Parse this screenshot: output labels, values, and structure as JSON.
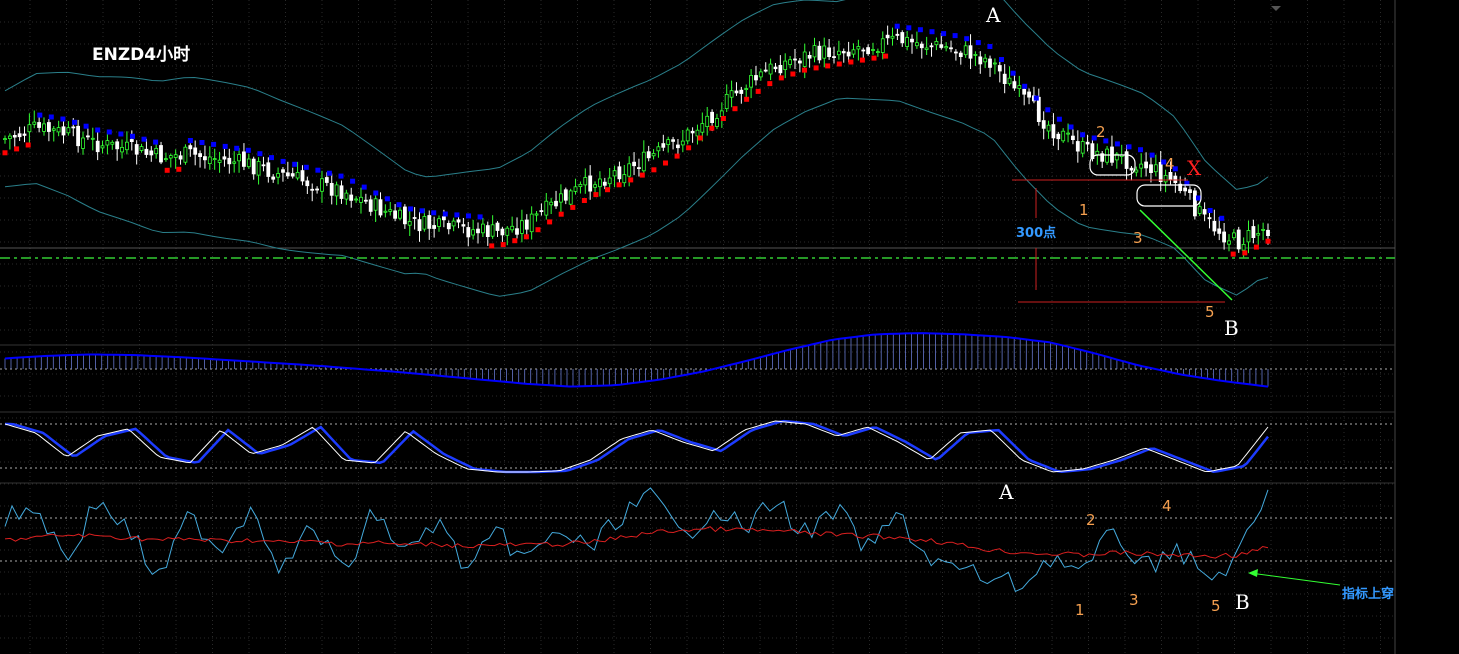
{
  "title": "ENZD4小时",
  "colors": {
    "background": "#000000",
    "bull_candle": "#33ff33",
    "bear_candle": "#ffffff",
    "sar_up": "#ff0000",
    "sar_down": "#0000ff",
    "bollinger": "#2a7f8a",
    "dashed_level": "#33cc33",
    "macd_line": "#0000ff",
    "macd_hist": "#6677cc",
    "stoch_main": "#ffffff",
    "stoch_signal": "#1d3cff",
    "osc_fast": "#44aadd",
    "osc_slow": "#dd2020",
    "annotation_orange": "#f5a050"
  },
  "annotations": {
    "price_A": "A",
    "price_B": "B",
    "price_X": "X",
    "wave_1": "1",
    "wave_2": "2",
    "wave_3": "3",
    "wave_4": "4",
    "wave_5": "5",
    "range_label": "300点",
    "osc_A": "A",
    "osc_B": "B",
    "osc_1": "1",
    "osc_2": "2",
    "osc_3": "3",
    "osc_4": "4",
    "osc_5": "5",
    "indicator_note": "指标上穿"
  },
  "chart_data": {
    "type": "line",
    "note_panels": [
      "price_candles_bollinger_sar",
      "macd",
      "stochastic",
      "oscillator"
    ],
    "price_curve": [
      0.62,
      0.66,
      0.64,
      0.6,
      0.58,
      0.55,
      0.56,
      0.54,
      0.52,
      0.48,
      0.45,
      0.42,
      0.36,
      0.3,
      0.28,
      0.27,
      0.26,
      0.3,
      0.38,
      0.45,
      0.5,
      0.55,
      0.62,
      0.72,
      0.82,
      0.9,
      0.94,
      0.96,
      0.98,
      1.0,
      0.98,
      0.96,
      0.92,
      0.78,
      0.66,
      0.58,
      0.55,
      0.52,
      0.45,
      0.3,
      0.22,
      0.28
    ],
    "macd_line": [
      0.62,
      0.66,
      0.68,
      0.67,
      0.64,
      0.6,
      0.56,
      0.52,
      0.47,
      0.42,
      0.36,
      0.3,
      0.24,
      0.2,
      0.22,
      0.3,
      0.42,
      0.58,
      0.75,
      0.9,
      0.98,
      1.0,
      0.98,
      0.94,
      0.86,
      0.7,
      0.52,
      0.38,
      0.28,
      0.2
    ],
    "stoch_main": [
      0.9,
      0.75,
      0.35,
      0.7,
      0.82,
      0.35,
      0.25,
      0.8,
      0.4,
      0.55,
      0.85,
      0.3,
      0.25,
      0.78,
      0.4,
      0.15,
      0.1,
      0.1,
      0.12,
      0.3,
      0.65,
      0.8,
      0.6,
      0.45,
      0.8,
      0.95,
      0.9,
      0.7,
      0.85,
      0.6,
      0.3,
      0.75,
      0.8,
      0.3,
      0.1,
      0.15,
      0.3,
      0.5,
      0.3,
      0.1,
      0.2,
      0.85
    ],
    "osc_fast": [
      0.7,
      0.85,
      0.3,
      0.9,
      0.6,
      0.1,
      0.75,
      0.4,
      0.85,
      0.2,
      0.65,
      0.15,
      0.8,
      0.35,
      0.7,
      0.2,
      0.55,
      0.3,
      0.6,
      0.4,
      0.75,
      0.95,
      0.5,
      0.85,
      0.6,
      0.9,
      0.55,
      0.8,
      0.4,
      0.75,
      0.3,
      0.2,
      0.1,
      0.05,
      0.35,
      0.15,
      0.6,
      0.2,
      0.45,
      0.1,
      0.3,
      0.95
    ],
    "osc_slow": [
      0.5,
      0.55,
      0.6,
      0.58,
      0.55,
      0.5,
      0.52,
      0.48,
      0.5,
      0.45,
      0.47,
      0.42,
      0.45,
      0.4,
      0.42,
      0.38,
      0.4,
      0.4,
      0.42,
      0.45,
      0.55,
      0.65,
      0.7,
      0.72,
      0.7,
      0.68,
      0.65,
      0.6,
      0.58,
      0.55,
      0.5,
      0.4,
      0.3,
      0.25,
      0.22,
      0.2,
      0.25,
      0.22,
      0.2,
      0.18,
      0.2,
      0.35
    ]
  }
}
